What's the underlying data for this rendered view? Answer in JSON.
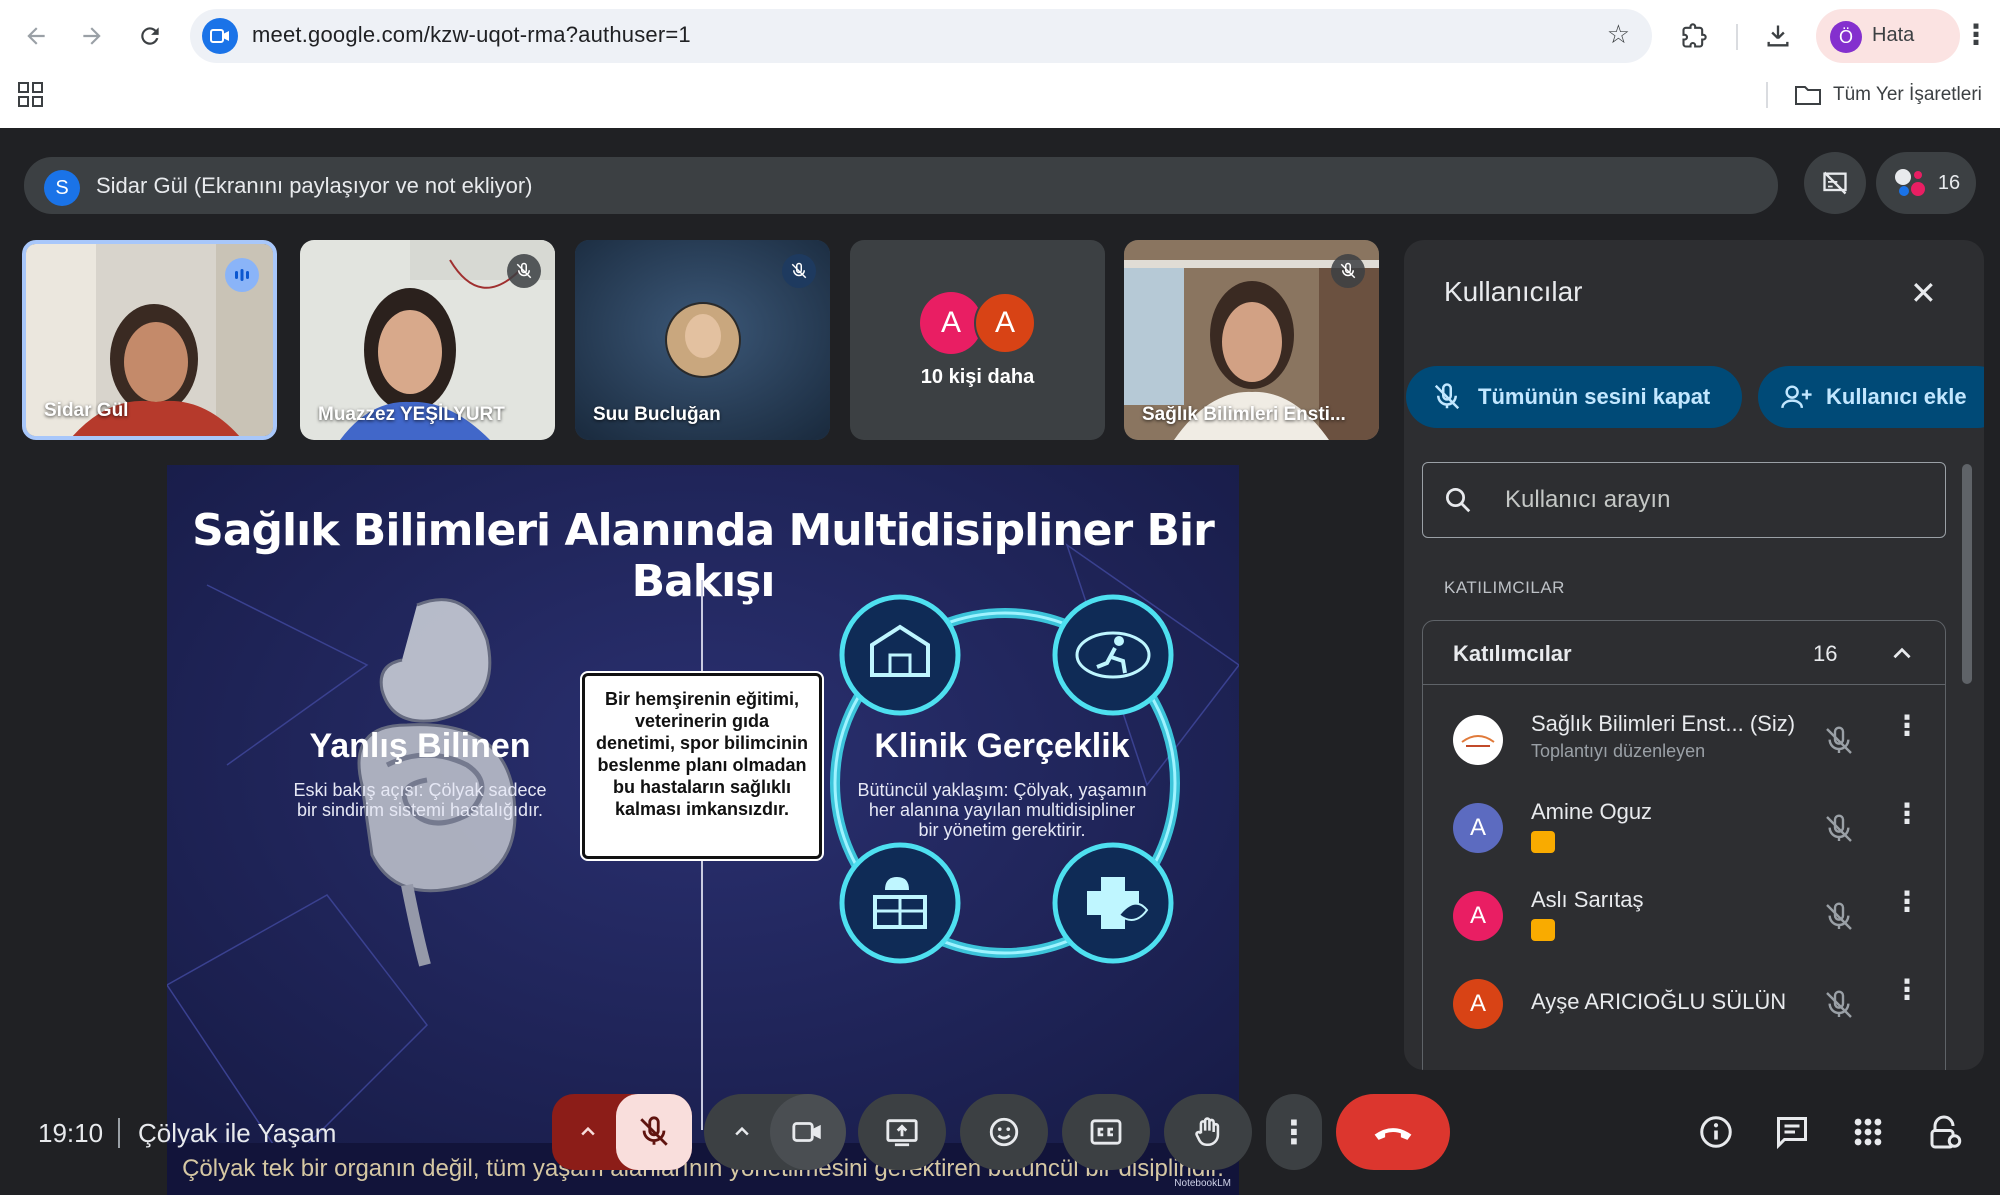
{
  "browser": {
    "url": "meet.google.com/kzw-uqot-rma?authuser=1",
    "profile_initial": "Ö",
    "profile_label": "Hata",
    "bookmarks_label": "Tüm Yer İşaretleri"
  },
  "meet": {
    "presenter_initial": "S",
    "presenter_banner": "Sidar Gül (Ekranını paylaşıyor ve not ekliyor)",
    "participant_count": "16",
    "tiles": [
      {
        "name": "Sidar Gül"
      },
      {
        "name": "Muazzez YEŞİLYURT"
      },
      {
        "name": "Suu Bucluğan"
      },
      {
        "name": "10 kişi daha",
        "initials": [
          "A",
          "A"
        ]
      },
      {
        "name": "Sağlık Bilimleri Ensti..."
      }
    ],
    "time": "19:10",
    "meeting_title": "Çölyak ile Yaşam"
  },
  "slide": {
    "title": "Sağlık Bilimleri Alanında Multidisipliner Bir Bakışı",
    "left_head": "Yanlış Bilinen",
    "left_sub": "Eski bakış açısı: Çölyak sadece bir sindirim sistemi hastalığıdır.",
    "center_text": "Bir hemşirenin eğitimi, veterinerin gıda denetimi, spor bilimcinin beslenme planı olmadan bu hastaların sağlıklı kalması imkansızdır.",
    "right_head": "Klinik Gerçeklik",
    "right_sub": "Bütüncül yaklaşım: Çölyak, yaşamın her alanına yayılan multidisipliner bir yönetim gerektirir.",
    "caption": "Çölyak tek bir organın değil, tüm yaşam alanlarının yönetilmesini gerektiren bütüncül bir disiplindir.",
    "watermark": "NotebookLM"
  },
  "panel": {
    "title": "Kullanıcılar",
    "mute_all": "Tümünün sesini kapat",
    "add_user": "Kullanıcı ekle",
    "search_placeholder": "Kullanıcı arayın",
    "section_label": "KATILIMCILAR",
    "group_title": "Katılımcılar",
    "group_count": "16",
    "people": [
      {
        "name": "Sağlık Bilimleri Enst... (Siz)",
        "sub": "Toplantıyı düzenleyen",
        "initial": "",
        "color": "#ffffff"
      },
      {
        "name": "Amine Oguz",
        "sub": "",
        "initial": "A",
        "color": "#5c6bc0"
      },
      {
        "name": "Aslı Sarıtaş",
        "sub": "",
        "initial": "A",
        "color": "#e91e63"
      },
      {
        "name": "Ayşe ARICIOĞLU SÜLÜN",
        "sub": "",
        "initial": "A",
        "color": "#d84315"
      }
    ]
  },
  "colors": {
    "accent_blue": "#0b57d0",
    "hangup_red": "#dc362e",
    "mic_off_bg": "#f9dedc"
  }
}
